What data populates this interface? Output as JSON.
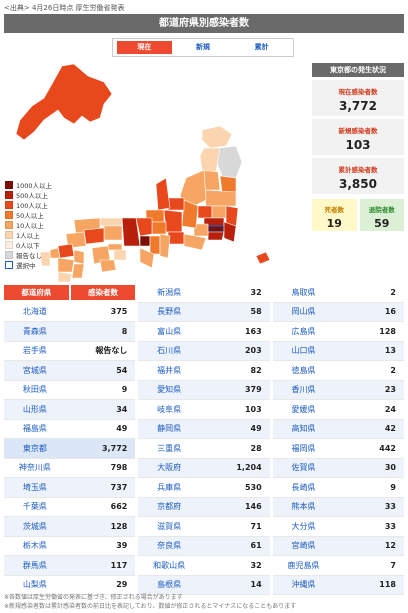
{
  "source": "<出典> 4月26日時点 厚生労働省発表",
  "title": "都道府県別感染者数",
  "tabs": [
    {
      "label": "現在",
      "active": true
    },
    {
      "label": "新規",
      "active": false
    },
    {
      "label": "累計",
      "active": false
    }
  ],
  "legend": [
    {
      "label": "1000人以上",
      "color": "#7a0f06"
    },
    {
      "label": "500人以上",
      "color": "#b8200c"
    },
    {
      "label": "100人以上",
      "color": "#e8491c"
    },
    {
      "label": "50人以上",
      "color": "#f07a2c"
    },
    {
      "label": "10人以上",
      "color": "#f6a562"
    },
    {
      "label": "1人以上",
      "color": "#fbd5b0"
    },
    {
      "label": "0人以下",
      "color": "#fdeee0"
    },
    {
      "label": "報告なし",
      "color": "#d8d8d8"
    },
    {
      "label": "選択中",
      "color": "#ffffff"
    }
  ],
  "side": {
    "heading": "東京都の発生状況",
    "current_label": "現在感染者数",
    "current_value": "3,772",
    "new_label": "新規感染者数",
    "new_value": "103",
    "total_label": "累計感染者数",
    "total_value": "3,850",
    "deaths_label": "死者数",
    "deaths_value": "19",
    "discharged_label": "退院者数",
    "discharged_value": "59"
  },
  "table_headers": {
    "pref": "都道府県",
    "count": "感染者数"
  },
  "columns": [
    [
      {
        "pref": "北海道",
        "val": "375"
      },
      {
        "pref": "青森県",
        "val": "8"
      },
      {
        "pref": "岩手県",
        "val": "報告なし"
      },
      {
        "pref": "宮城県",
        "val": "54"
      },
      {
        "pref": "秋田県",
        "val": "9"
      },
      {
        "pref": "山形県",
        "val": "34"
      },
      {
        "pref": "福島県",
        "val": "49"
      },
      {
        "pref": "東京都",
        "val": "3,772",
        "selected": true
      },
      {
        "pref": "神奈川県",
        "val": "798"
      },
      {
        "pref": "埼玉県",
        "val": "737"
      },
      {
        "pref": "千葉県",
        "val": "662"
      },
      {
        "pref": "茨城県",
        "val": "128"
      },
      {
        "pref": "栃木県",
        "val": "39"
      },
      {
        "pref": "群馬県",
        "val": "117"
      },
      {
        "pref": "山梨県",
        "val": "29"
      }
    ],
    [
      {
        "pref": "新潟県",
        "val": "32"
      },
      {
        "pref": "長野県",
        "val": "58"
      },
      {
        "pref": "富山県",
        "val": "163"
      },
      {
        "pref": "石川県",
        "val": "203"
      },
      {
        "pref": "福井県",
        "val": "82"
      },
      {
        "pref": "愛知県",
        "val": "379"
      },
      {
        "pref": "岐阜県",
        "val": "103"
      },
      {
        "pref": "静岡県",
        "val": "49"
      },
      {
        "pref": "三重県",
        "val": "28"
      },
      {
        "pref": "大阪府",
        "val": "1,204"
      },
      {
        "pref": "兵庫県",
        "val": "530"
      },
      {
        "pref": "京都府",
        "val": "146"
      },
      {
        "pref": "滋賀県",
        "val": "71"
      },
      {
        "pref": "奈良県",
        "val": "61"
      },
      {
        "pref": "和歌山県",
        "val": "32"
      },
      {
        "pref": "島根県",
        "val": "14"
      }
    ],
    [
      {
        "pref": "鳥取県",
        "val": "2"
      },
      {
        "pref": "岡山県",
        "val": "16"
      },
      {
        "pref": "広島県",
        "val": "128"
      },
      {
        "pref": "山口県",
        "val": "13"
      },
      {
        "pref": "徳島県",
        "val": "2"
      },
      {
        "pref": "香川県",
        "val": "23"
      },
      {
        "pref": "愛媛県",
        "val": "24"
      },
      {
        "pref": "高知県",
        "val": "42"
      },
      {
        "pref": "福岡県",
        "val": "442"
      },
      {
        "pref": "佐賀県",
        "val": "30"
      },
      {
        "pref": "長崎県",
        "val": "9"
      },
      {
        "pref": "熊本県",
        "val": "33"
      },
      {
        "pref": "大分県",
        "val": "33"
      },
      {
        "pref": "宮崎県",
        "val": "12"
      },
      {
        "pref": "鹿児島県",
        "val": "7"
      },
      {
        "pref": "沖縄県",
        "val": "118"
      }
    ]
  ],
  "notes": [
    "※各数値は厚生労働省の発表に基づき、修正される場合があります",
    "※新規感染者数は累計感染者数の前日比を表記しており、数値が修正されるとマイナスになることもあります"
  ]
}
